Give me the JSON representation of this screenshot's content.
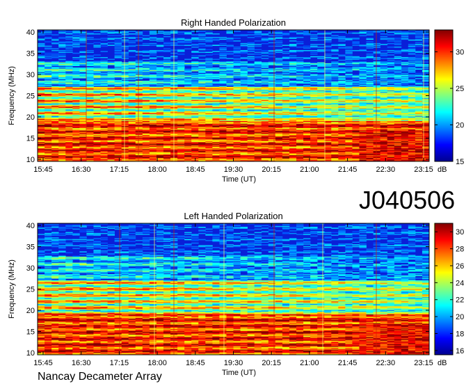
{
  "figure": {
    "label": "J040506",
    "footer": "Nancay Decameter Array"
  },
  "chart_data": [
    {
      "type": "heatmap",
      "title": "Right Handed Polarization",
      "xlabel": "Time (UT)",
      "ylabel": "Frequency (MHz)",
      "x_ticks": [
        "15:45",
        "16:30",
        "17:15",
        "18:00",
        "18:45",
        "19:30",
        "20:15",
        "21:00",
        "21:45",
        "22:30",
        "23:15"
      ],
      "y_ticks": [
        10,
        15,
        20,
        25,
        30,
        35,
        40
      ],
      "ylim": [
        9.5,
        40.5
      ],
      "colorbar": {
        "label": "dB",
        "ticks": [
          15,
          20,
          25,
          30
        ],
        "range": [
          15,
          33
        ]
      },
      "colors": {
        "low": "#00008f",
        "mid": "#00ffff",
        "high": "#800000"
      }
    },
    {
      "type": "heatmap",
      "title": "Left Handed Polarization",
      "xlabel": "Time (UT)",
      "ylabel": "Frequency (MHz)",
      "x_ticks": [
        "15:45",
        "16:30",
        "17:15",
        "18:00",
        "18:45",
        "19:30",
        "20:15",
        "21:00",
        "21:45",
        "22:30",
        "23:15"
      ],
      "y_ticks": [
        10,
        15,
        20,
        25,
        30,
        35,
        40
      ],
      "ylim": [
        9.5,
        40.5
      ],
      "colorbar": {
        "label": "dB",
        "ticks": [
          16,
          18,
          20,
          22,
          24,
          26,
          28,
          30
        ],
        "range": [
          15.5,
          31
        ]
      },
      "colors": {
        "low": "#00008f",
        "mid": "#00ffff",
        "high": "#800000"
      }
    }
  ]
}
